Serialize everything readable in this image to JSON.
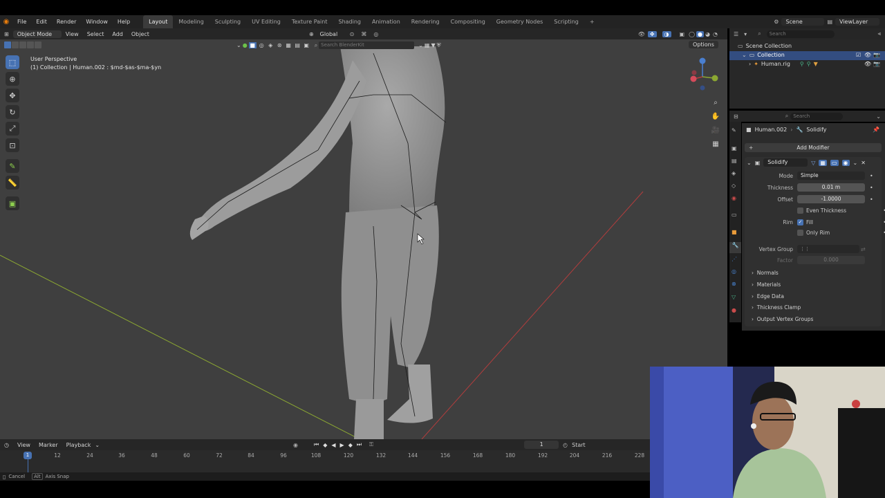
{
  "menu": {
    "items": [
      "File",
      "Edit",
      "Render",
      "Window",
      "Help"
    ],
    "workspaces": [
      "Layout",
      "Modeling",
      "Sculpting",
      "UV Editing",
      "Texture Paint",
      "Shading",
      "Animation",
      "Rendering",
      "Compositing",
      "Geometry Nodes",
      "Scripting"
    ],
    "active_workspace": "Layout",
    "add_tab": "+",
    "scene": "Scene",
    "view_layer": "ViewLayer"
  },
  "viewport_header": {
    "mode": "Object Mode",
    "menus": [
      "View",
      "Select",
      "Add",
      "Object"
    ],
    "transform": "Global",
    "search_placeholder": "Search BlenderKit",
    "options": "Options"
  },
  "viewport": {
    "perspective": "User Perspective",
    "collection_info": "(1) Collection | Human.002 : $md-$as-$ma-$yn"
  },
  "outliner": {
    "search_placeholder": "Search",
    "root": "Scene Collection",
    "collection": "Collection",
    "object": "Human.rig"
  },
  "properties": {
    "search_placeholder": "Search",
    "breadcrumb_object": "Human.002",
    "breadcrumb_modifier": "Solidify",
    "add_modifier": "Add Modifier",
    "modifier_name": "Solidify",
    "mode_label": "Mode",
    "mode_value": "Simple",
    "thickness_label": "Thickness",
    "thickness_value": "0.01 m",
    "offset_label": "Offset",
    "offset_value": "-1.0000",
    "even_thickness": "Even Thickness",
    "rim_label": "Rim",
    "fill": "Fill",
    "only_rim": "Only Rim",
    "vertex_group_label": "Vertex Group",
    "factor_label": "Factor",
    "factor_value": "0.000",
    "sections": [
      "Normals",
      "Materials",
      "Edge Data",
      "Thickness Clamp",
      "Output Vertex Groups"
    ]
  },
  "timeline": {
    "menus": [
      "View",
      "Marker",
      "Playback"
    ],
    "current_frame": "1",
    "start_label": "Start",
    "frame_ticks": [
      "12",
      "24",
      "36",
      "48",
      "60",
      "72",
      "84",
      "96",
      "108",
      "120",
      "132",
      "144",
      "156",
      "168",
      "180",
      "192",
      "204",
      "216",
      "228"
    ],
    "playhead": "1"
  },
  "statusbar": {
    "cancel": "Cancel",
    "alt": "Alt",
    "axis_snap": "Axis Snap"
  },
  "colors": {
    "accent": "#4772b3",
    "viewport_bg": "#3f3f3f",
    "x_axis": "#b33d3d",
    "y_axis": "#8ca832"
  }
}
